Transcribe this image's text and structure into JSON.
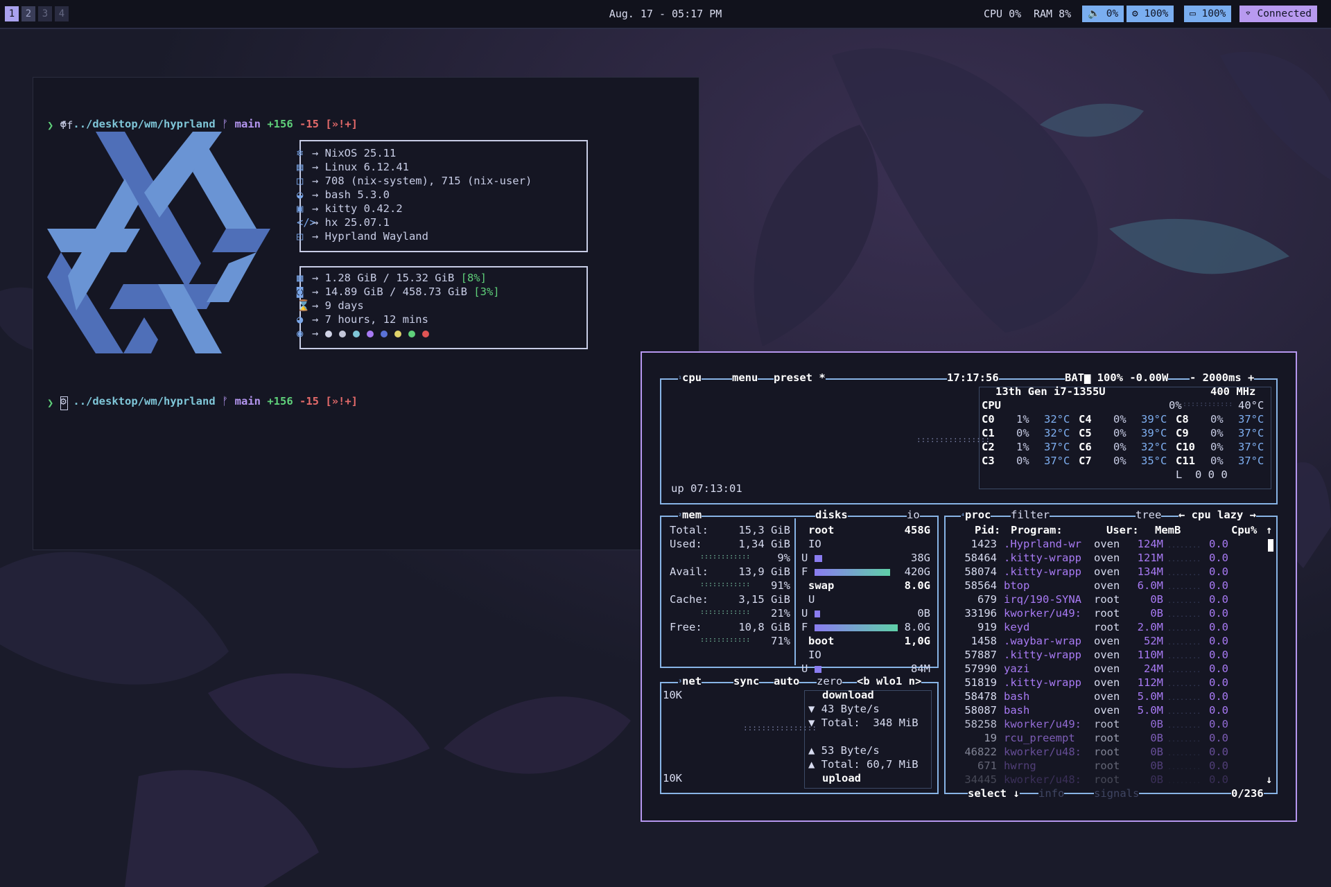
{
  "colors": {
    "accent": "#b697f0",
    "term_bg": "#151623",
    "bar_bg": "#11121c",
    "btop_border": "#88b4e6"
  },
  "bar": {
    "workspaces": [
      "1",
      "2",
      "3",
      "4"
    ],
    "clock": "Aug. 17 - 05:17 PM",
    "cpu": "CPU 0%",
    "ram": "RAM 8%",
    "volume": "🔈 0%",
    "brightness": "⚙ 100%",
    "battery": "▭ 100%",
    "network": "Connected"
  },
  "term1": {
    "prompt_path": "../desktop/wm/hyprland",
    "branch_icon": "ᚠ",
    "branch": "main",
    "added": "+156",
    "removed": "-15",
    "status": "[»!+]",
    "cmd_prompt": "❯",
    "command": "ff",
    "ff_rows1": [
      {
        "icon": "❄",
        "text": "→ NixOS 25.11"
      },
      {
        "icon": "▤",
        "text": "→ Linux 6.12.41"
      },
      {
        "icon": "◫",
        "text": "→ 708 (nix-system), 715 (nix-user)"
      },
      {
        "icon": "◒",
        "text": "→ bash 5.3.0"
      },
      {
        "icon": "▣",
        "text": "→ kitty 0.42.2"
      },
      {
        "icon": "</>",
        "text": "→ hx 25.07.1"
      },
      {
        "icon": "◰",
        "text": "→ Hyprland Wayland"
      }
    ],
    "ff_rows2": [
      {
        "icon": "▦",
        "text": "→ 1.28 GiB / 15.32 GiB ",
        "pct": "[8%]"
      },
      {
        "icon": "◙",
        "text": "→ 14.89 GiB / 458.73 GiB ",
        "pct": "[3%]"
      },
      {
        "icon": "⌛",
        "text": "→ 9 days"
      },
      {
        "icon": "◕",
        "text": "→ 7 hours, 12 mins"
      }
    ],
    "palette_icon": "◉",
    "palette_arrow": "→",
    "palette": [
      "#d0d3e6",
      "#c4c7da",
      "#7fc6d8",
      "#a87af4",
      "#5a72d8",
      "#e0d26a",
      "#5fd07a",
      "#e05454"
    ]
  },
  "btop": {
    "cpu_title": "cpu",
    "menu": "menu",
    "preset": "preset *",
    "clock": "17:17:56",
    "bat": "BAT▆ 100% -0.00W",
    "interval": "- 2000ms +",
    "cpu_model": "13th Gen i7-1355U",
    "freq": "400 MHz",
    "cpu_label": "CPU",
    "cpu_total": "0%",
    "cpu_temp": "40°C",
    "cores": [
      [
        "C0",
        "1%",
        "32°C",
        "C4",
        "0%",
        "39°C",
        "C8",
        "0%",
        "37°C"
      ],
      [
        "C1",
        "0%",
        "32°C",
        "C5",
        "0%",
        "39°C",
        "C9",
        "0%",
        "37°C"
      ],
      [
        "C2",
        "1%",
        "37°C",
        "C6",
        "0%",
        "32°C",
        "C10",
        "0%",
        "37°C"
      ],
      [
        "C3",
        "0%",
        "37°C",
        "C7",
        "0%",
        "35°C",
        "C11",
        "0%",
        "37°C"
      ]
    ],
    "load": "L  0 0 0",
    "uptime": "up 07:13:01",
    "mem_title": "mem",
    "disks_title": "disks",
    "io_title": "io",
    "mem": [
      {
        "k": "Total:",
        "v": "15,3 GiB"
      },
      {
        "k": "Used:",
        "v": "1,34 GiB",
        "pct": "9%"
      },
      {
        "k": "Avail:",
        "v": "13,9 GiB",
        "pct": "91%"
      },
      {
        "k": "Cache:",
        "v": "3,15 GiB",
        "pct": "21%"
      },
      {
        "k": "Free:",
        "v": "10,8 GiB",
        "pct": "71%"
      }
    ],
    "disks": [
      {
        "name": "root",
        "size": "458G",
        "io": "IO",
        "u": "38G",
        "f": "420G",
        "u_frac": 0.09,
        "f_frac": 0.91
      },
      {
        "name": "swap",
        "size": "8.0G",
        "io": "U",
        "u": "0B",
        "f": "8.0G",
        "u_frac": 0,
        "f_frac": 1.0
      },
      {
        "name": "boot",
        "size": "1,0G",
        "io": "IO",
        "u": "84M",
        "u_frac": 0.08
      }
    ],
    "net_title": "net",
    "sync": "sync",
    "auto": "auto",
    "zero": "zero",
    "iface": "<b wlo1 n>",
    "net_scale_top": "10K",
    "net_scale_bottom": "10K",
    "download_label": "download",
    "down_rate": "▼ 43 Byte/s",
    "down_total": "▼ Total:  348 MiB",
    "up_rate": "▲ 53 Byte/s",
    "up_total": "▲ Total: 60,7 MiB",
    "upload_label": "upload",
    "proc_title": "proc",
    "filter": "filter",
    "tree": "tree",
    "sort": "← cpu lazy →",
    "proc_headers": {
      "pid": "Pid:",
      "program": "Program:",
      "user": "User:",
      "mem": "MemB",
      "cpu": "Cpu%"
    },
    "procs": [
      {
        "pid": "1423",
        "prog": ".Hyprland-wr",
        "user": "oven",
        "mem": "124M",
        "cpu": "0.0"
      },
      {
        "pid": "58464",
        "prog": ".kitty-wrapp",
        "user": "oven",
        "mem": "121M",
        "cpu": "0.0"
      },
      {
        "pid": "58074",
        "prog": ".kitty-wrapp",
        "user": "oven",
        "mem": "134M",
        "cpu": "0.0"
      },
      {
        "pid": "58564",
        "prog": "btop",
        "user": "oven",
        "mem": "6.0M",
        "cpu": "0.0"
      },
      {
        "pid": "679",
        "prog": "irq/190-SYNA",
        "user": "root",
        "mem": "0B",
        "cpu": "0.0"
      },
      {
        "pid": "33196",
        "prog": "kworker/u49:",
        "user": "root",
        "mem": "0B",
        "cpu": "0.0"
      },
      {
        "pid": "919",
        "prog": "keyd",
        "user": "root",
        "mem": "2.0M",
        "cpu": "0.0"
      },
      {
        "pid": "1458",
        "prog": ".waybar-wrap",
        "user": "oven",
        "mem": "52M",
        "cpu": "0.0"
      },
      {
        "pid": "57887",
        "prog": ".kitty-wrapp",
        "user": "oven",
        "mem": "110M",
        "cpu": "0.0"
      },
      {
        "pid": "57990",
        "prog": "yazi",
        "user": "oven",
        "mem": "24M",
        "cpu": "0.0"
      },
      {
        "pid": "51819",
        "prog": ".kitty-wrapp",
        "user": "oven",
        "mem": "112M",
        "cpu": "0.0"
      },
      {
        "pid": "58478",
        "prog": "bash",
        "user": "oven",
        "mem": "5.0M",
        "cpu": "0.0"
      },
      {
        "pid": "58087",
        "prog": "bash",
        "user": "oven",
        "mem": "5.0M",
        "cpu": "0.0"
      },
      {
        "pid": "58258",
        "prog": "kworker/u49:",
        "user": "root",
        "mem": "0B",
        "cpu": "0.0"
      },
      {
        "pid": "19",
        "prog": "rcu_preempt",
        "user": "root",
        "mem": "0B",
        "cpu": "0.0"
      },
      {
        "pid": "46822",
        "prog": "kworker/u48:",
        "user": "root",
        "mem": "0B",
        "cpu": "0.0"
      },
      {
        "pid": "671",
        "prog": "hwrng",
        "user": "root",
        "mem": "0B",
        "cpu": "0.0"
      },
      {
        "pid": "34445",
        "prog": "kworker/u48:",
        "user": "root",
        "mem": "0B",
        "cpu": "0.0"
      }
    ],
    "select": "select ↓",
    "info": "info",
    "signals": "signals",
    "count": "0/236"
  }
}
